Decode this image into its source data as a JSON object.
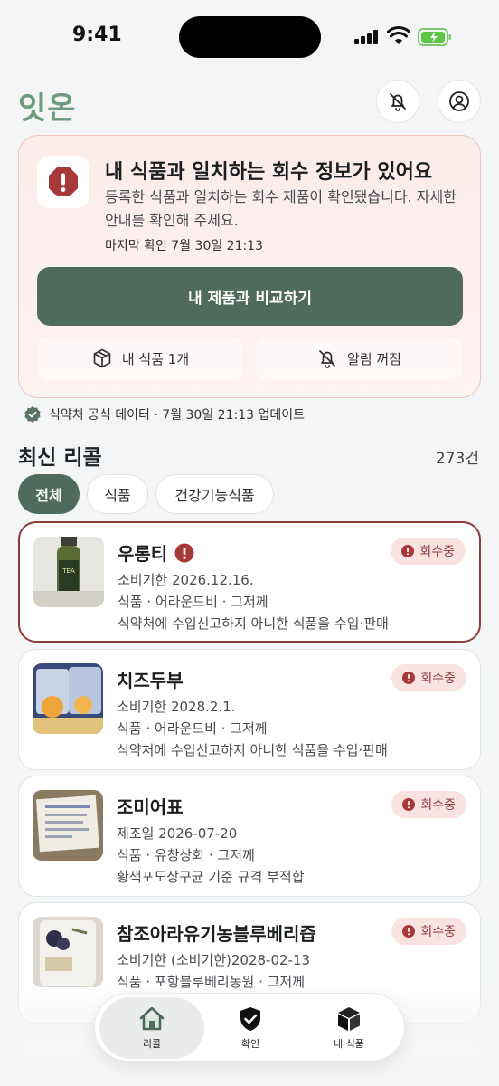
{
  "status_bar": {
    "time": "9:41"
  },
  "header": {
    "app_title": "잇온",
    "notification_icon": "bell-off-icon",
    "profile_icon": "user-circle-icon"
  },
  "alert": {
    "title": "내 식품과 일치하는 회수 정보가 있어요",
    "description": "등록한 식품과 일치하는 회수 제품이 확인됐습니다. 자세한 안내를 확인해 주세요.",
    "last_checked": "마지막 확인 7월 30일 21:13",
    "compare_button": "내 제품과 비교하기",
    "my_foods_button": "내 식품 1개",
    "notifications_button": "알림 꺼짐",
    "accent_color": "#a8393a"
  },
  "source": {
    "text": "식약처 공식 데이터 · 7월 30일 21:13 업데이트"
  },
  "section": {
    "title": "최신 리콜",
    "count": "273건"
  },
  "filters": [
    {
      "label": "전체",
      "active": true
    },
    {
      "label": "식품",
      "active": false
    },
    {
      "label": "건강기능식품",
      "active": false
    }
  ],
  "recalls": [
    {
      "name": "우롱티",
      "date": "소비기한 2026.12.16.",
      "meta": "식품 · 어라운드비 · 그저께",
      "reason": "식약처에 수입신고하지 아니한 식품을 수입·판매",
      "badge": "회수중",
      "matched": true
    },
    {
      "name": "치즈두부",
      "date": "소비기한 2028.2.1.",
      "meta": "식품 · 어라운드비 · 그저께",
      "reason": "식약처에 수입신고하지 아니한 식품을 수입·판매",
      "badge": "회수중",
      "matched": false
    },
    {
      "name": "조미어표",
      "date": "제조일 2026-07-20",
      "meta": "식품 · 유창상회 · 그저께",
      "reason": "황색포도상구균 기준 규격 부적합",
      "badge": "회수중",
      "matched": false
    },
    {
      "name": "참조아라유기농블루베리즙",
      "date": "소비기한 (소비기한)2028-02-13",
      "meta": "식품 · 포항블루베리농원 · 그저께",
      "reason": "",
      "badge": "회수중",
      "matched": false
    }
  ],
  "nav": [
    {
      "label": "리콜",
      "icon": "home-icon",
      "active": true
    },
    {
      "label": "확인",
      "icon": "shield-check-icon",
      "active": false
    },
    {
      "label": "내 식품",
      "icon": "box-icon",
      "active": false
    }
  ]
}
